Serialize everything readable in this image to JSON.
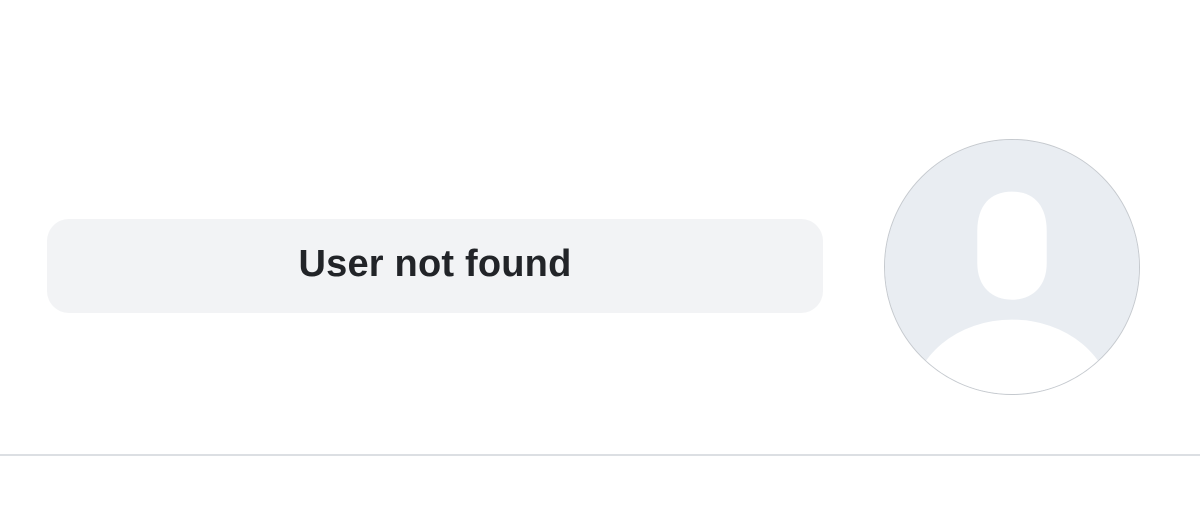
{
  "profile": {
    "status_message": "User not found",
    "avatar_icon": "default-avatar-silhouette-icon"
  },
  "colors": {
    "background": "#ffffff",
    "pill_background": "#f2f3f5",
    "text": "#222428",
    "avatar_background": "#e9edf2",
    "avatar_silhouette": "#ffffff",
    "avatar_border": "#c5c9ce",
    "divider": "#dcdfe3"
  }
}
